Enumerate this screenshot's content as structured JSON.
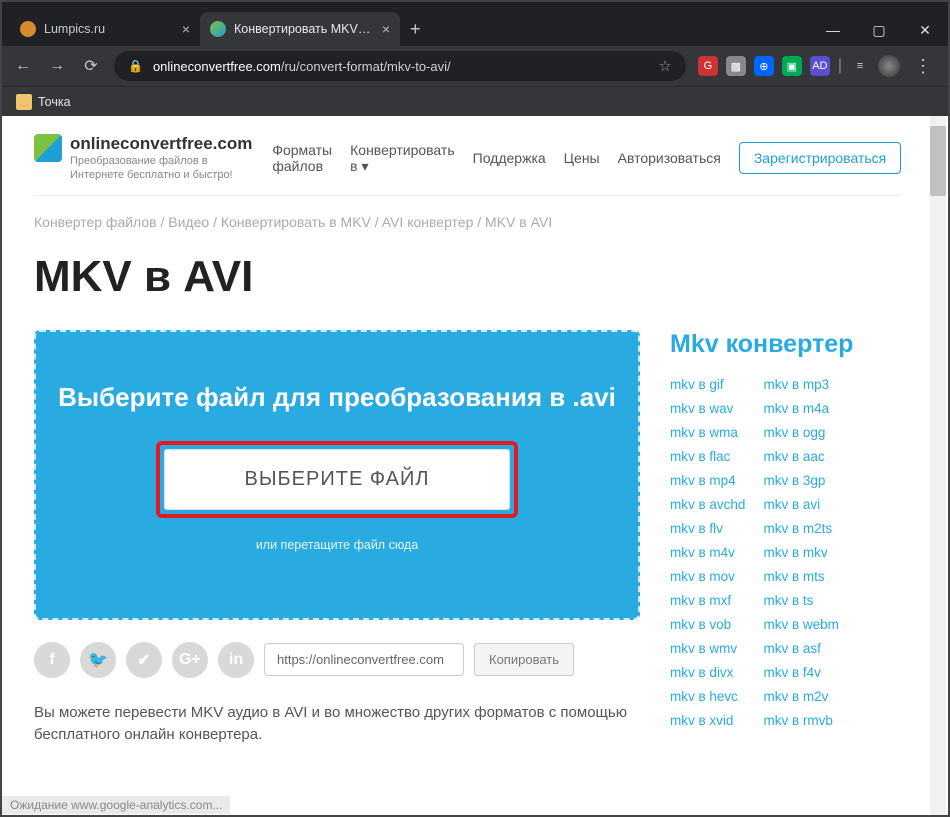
{
  "browser": {
    "tabs": [
      {
        "title": "Lumpics.ru",
        "active": false
      },
      {
        "title": "Конвертировать MKV в AVI онл",
        "active": true
      }
    ],
    "url_host": "onlineconvertfree.com",
    "url_path": "/ru/convert-format/mkv-to-avi/",
    "bookmark": "Точка"
  },
  "site": {
    "name": "onlineconvertfree.com",
    "tagline": "Преобразование файлов в Интернете бесплатно и быстро!",
    "nav": {
      "formats": "Форматы файлов",
      "convert": "Конвертировать в",
      "support": "Поддержка",
      "prices": "Цены",
      "login": "Авторизоваться",
      "signup": "Зарегистрироваться"
    }
  },
  "crumbs": "Конвертер файлов / Видео / Конвертировать в MKV / AVI конвертер / MKV в AVI",
  "h1": "MKV в AVI",
  "dropzone": {
    "title": "Выберите файл для преобразования в .avi",
    "button": "ВЫБЕРИТЕ ФАЙЛ",
    "hint": "или перетащите файл сюда"
  },
  "share": {
    "url": "https://onlineconvertfree.com",
    "copy": "Копировать"
  },
  "description": "Вы можете перевести MKV аудио в AVI и во множество других форматов с помощью бесплатного онлайн конвертера.",
  "sidebar": {
    "title": "Mkv конвертер",
    "col1": [
      "mkv в gif",
      "mkv в wav",
      "mkv в wma",
      "mkv в flac",
      "mkv в mp4",
      "mkv в avchd",
      "mkv в flv",
      "mkv в m4v",
      "mkv в mov",
      "mkv в mxf",
      "mkv в vob",
      "mkv в wmv",
      "mkv в divx",
      "mkv в hevc",
      "mkv в xvid"
    ],
    "col2": [
      "mkv в mp3",
      "mkv в m4a",
      "mkv в ogg",
      "mkv в aac",
      "mkv в 3gp",
      "mkv в avi",
      "mkv в m2ts",
      "mkv в mkv",
      "mkv в mts",
      "mkv в ts",
      "mkv в webm",
      "mkv в asf",
      "mkv в f4v",
      "mkv в m2v",
      "mkv в rmvb"
    ]
  },
  "status": "Ожидание www.google-analytics.com..."
}
